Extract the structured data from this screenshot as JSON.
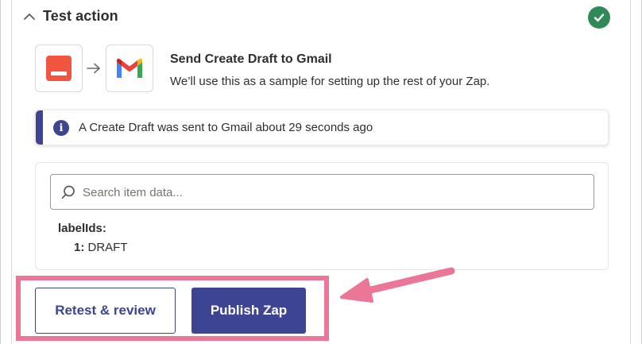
{
  "header": {
    "title": "Test action",
    "status_icon": "check-circle-icon",
    "status_color": "#2f8a56"
  },
  "apps": {
    "trigger_icon": "app-trigger-logo-icon",
    "trigger_color": "#f1543f",
    "action_icon": "gmail-logo-icon"
  },
  "step": {
    "title": "Send Create Draft to Gmail",
    "subtitle": "We’ll use this as a sample for setting up the rest of your Zap."
  },
  "info": {
    "text": "A Create Draft was sent to Gmail about 29 seconds ago",
    "accent": "#3d4592"
  },
  "data_panel": {
    "search_placeholder": "Search item data...",
    "key": "labelIds:",
    "items": [
      {
        "index": "1:",
        "value": "DRAFT"
      }
    ]
  },
  "actions": {
    "retest_label": "Retest & review",
    "publish_label": "Publish Zap"
  },
  "colors": {
    "primary": "#3d4592",
    "highlight": "#eb7697"
  }
}
